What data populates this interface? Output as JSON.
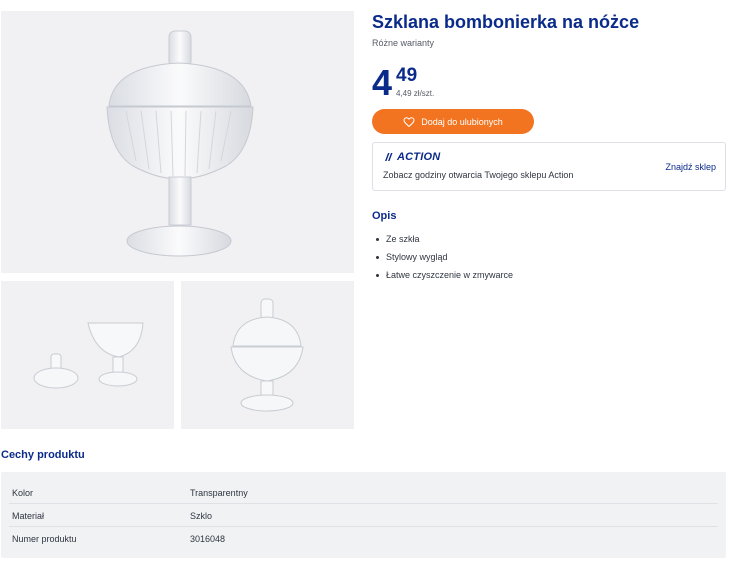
{
  "product": {
    "title": "Szklana bombonierka na nóżce",
    "variants_label": "Różne warianty"
  },
  "price": {
    "integer": "4",
    "decimal": "49",
    "unit_price": "4,49 zł/szt."
  },
  "favorite_button": {
    "label": "Dodaj do ulubionych",
    "icon": "heart-icon",
    "color": "#f27420"
  },
  "store": {
    "logo_text": "ACTION",
    "info_text": "Zobacz godziny otwarcia Twojego sklepu Action",
    "link_label": "Znajdź sklep"
  },
  "description": {
    "title": "Opis",
    "items": [
      "Ze szkła",
      "Stylowy wygląd",
      "Łatwe czyszczenie w zmywarce"
    ]
  },
  "features": {
    "title": "Cechy produktu",
    "rows": [
      {
        "key": "Kolor",
        "value": "Transparentny"
      },
      {
        "key": "Materiał",
        "value": "Szklo"
      },
      {
        "key": "Numer produktu",
        "value": "3016048"
      }
    ]
  },
  "colors": {
    "brand_blue": "#0b2b8a",
    "accent_orange": "#f27420",
    "image_bg": "#f1f1f3"
  }
}
